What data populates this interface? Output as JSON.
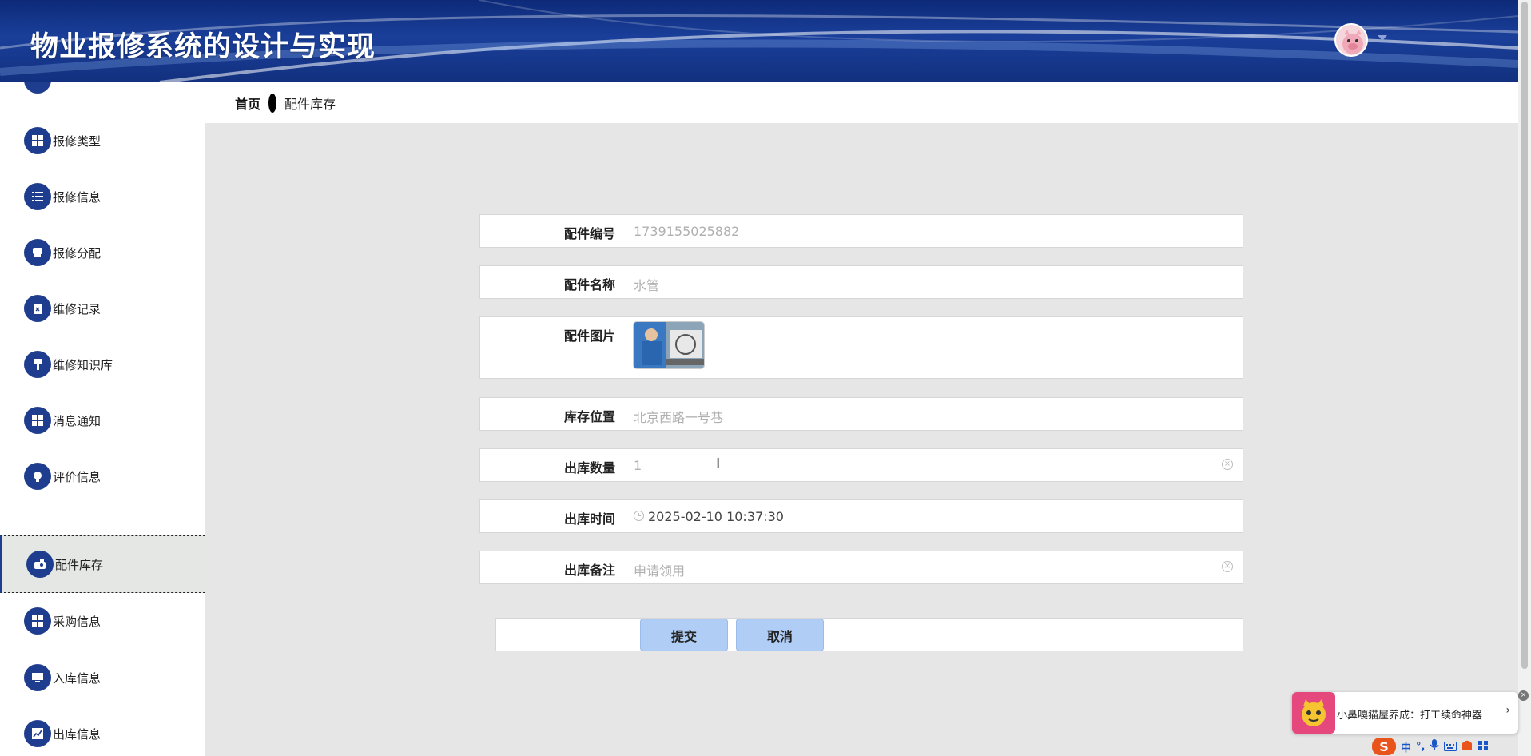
{
  "header": {
    "title": "物业报修系统的设计与实现"
  },
  "sidebar": {
    "items": [
      {
        "label": "报修类型",
        "icon": "grid-icon"
      },
      {
        "label": "报修信息",
        "icon": "list-icon"
      },
      {
        "label": "报修分配",
        "icon": "print-icon"
      },
      {
        "label": "维修记录",
        "icon": "clipboard-icon"
      },
      {
        "label": "维修知识库",
        "icon": "brush-icon"
      },
      {
        "label": "消息通知",
        "icon": "grid-icon"
      },
      {
        "label": "评价信息",
        "icon": "bulb-icon"
      },
      {
        "label": "配件库存",
        "icon": "camera-icon",
        "active": true
      },
      {
        "label": "采购信息",
        "icon": "grid-icon"
      },
      {
        "label": "入库信息",
        "icon": "monitor-icon"
      },
      {
        "label": "出库信息",
        "icon": "chart-icon"
      }
    ]
  },
  "breadcrumb": {
    "home": "首页",
    "current": "配件库存"
  },
  "form": {
    "part_no": {
      "label": "配件编号",
      "value": "1739155025882"
    },
    "part_name": {
      "label": "配件名称",
      "value": "水管"
    },
    "part_image": {
      "label": "配件图片"
    },
    "location": {
      "label": "库存位置",
      "value": "北京西路一号巷"
    },
    "out_qty": {
      "label": "出库数量",
      "value": "1"
    },
    "out_time": {
      "label": "出库时间",
      "value": "2025-02-10 10:37:30"
    },
    "out_note": {
      "label": "出库备注",
      "value": "申请领用"
    }
  },
  "buttons": {
    "submit": "提交",
    "cancel": "取消"
  },
  "toast": {
    "text": "小鼻嘎猫屋养成：打工续命神器"
  },
  "ime": {
    "logo": "S",
    "lang": "中",
    "punct": "°,"
  },
  "colors": {
    "header": "#12307e",
    "accent": "#1f3d8e",
    "button": "#b0cef5"
  }
}
